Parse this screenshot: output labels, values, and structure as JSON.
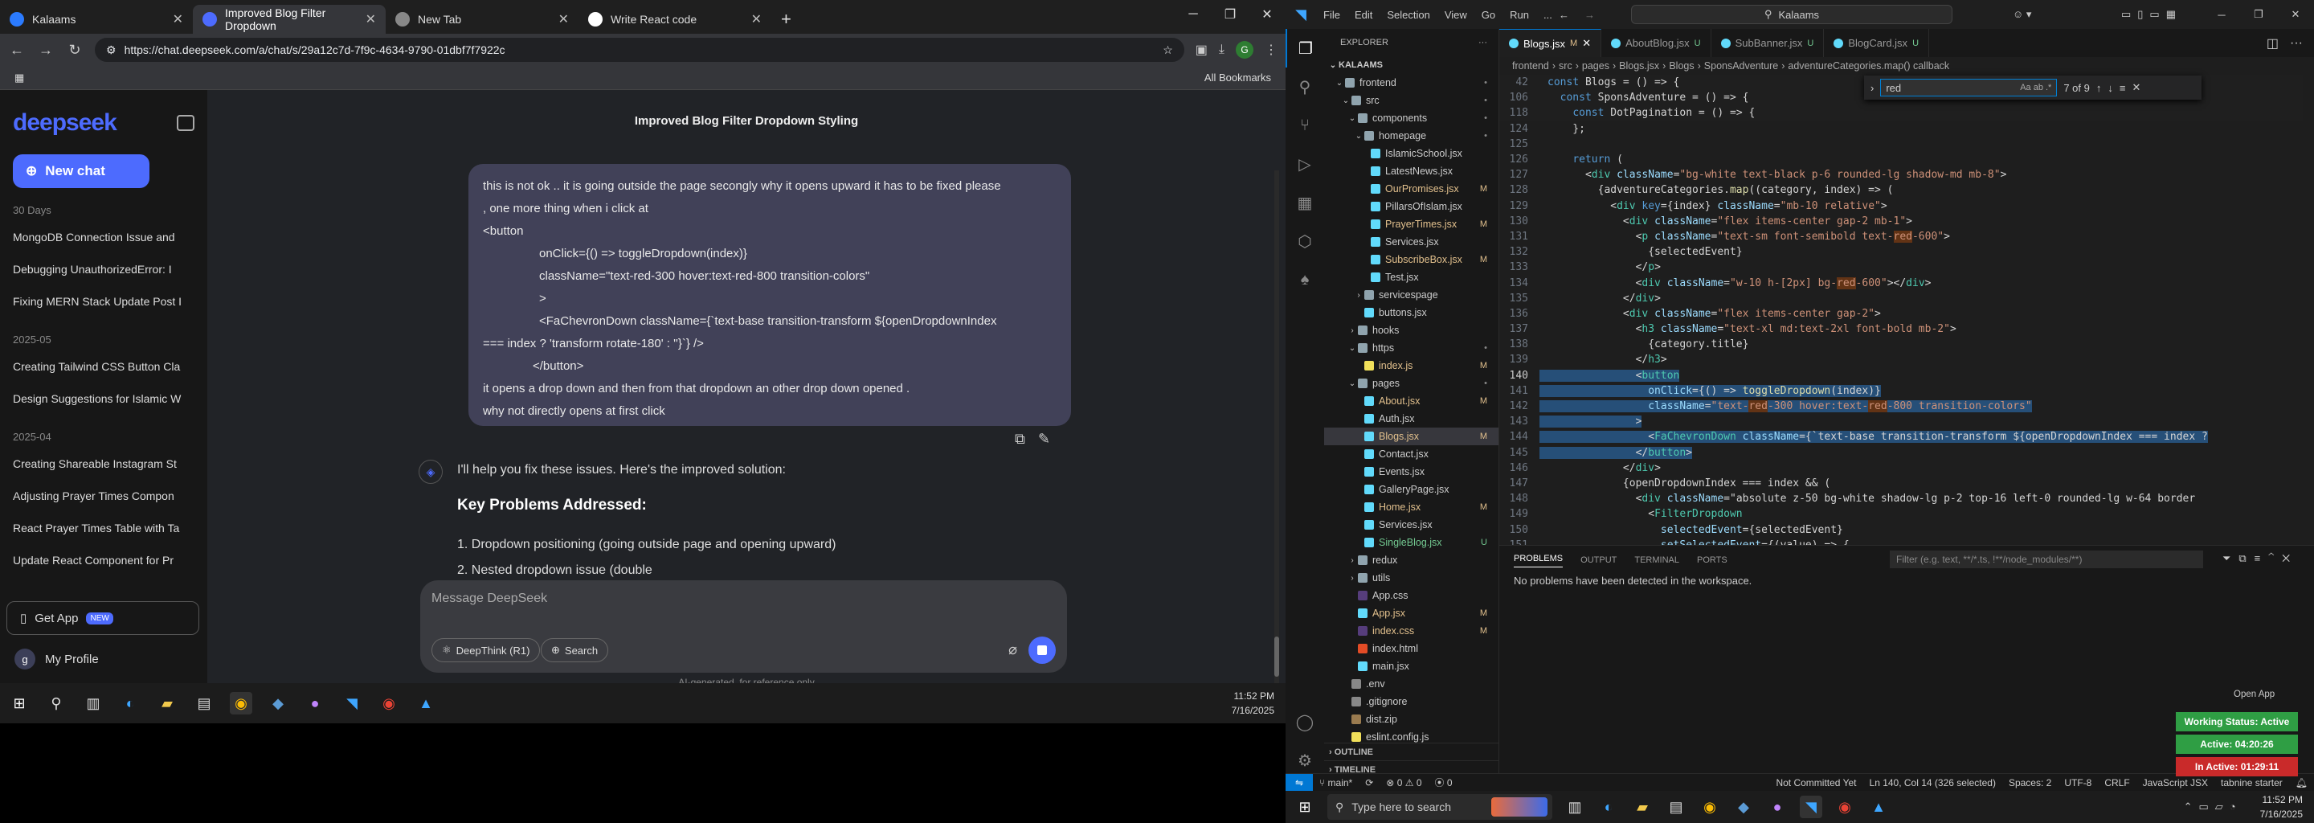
{
  "browser": {
    "tabs": [
      {
        "title": "Kalaams",
        "icon_color": "#2b7bff"
      },
      {
        "title": "Improved Blog Filter Dropdown",
        "icon_color": "#4d6bfe"
      },
      {
        "title": "New Tab",
        "icon_color": "#888888"
      },
      {
        "title": "Write React code",
        "icon_color": "#ffffff"
      }
    ],
    "url": "https://chat.deepseek.com/a/chat/s/29a12c7d-7f9c-4634-9790-01dbf7f7922c",
    "all_bookmarks": "All Bookmarks",
    "profile_letter": "G"
  },
  "deepseek": {
    "logo": "deepseek",
    "new_chat": "New chat",
    "sections": [
      {
        "label": "30 Days",
        "items": [
          "MongoDB Connection Issue and",
          "Debugging UnauthorizedError: I",
          "Fixing MERN Stack Update Post I"
        ]
      },
      {
        "label": "2025-05",
        "items": [
          "Creating Tailwind CSS Button Cla",
          "Design Suggestions for Islamic W"
        ]
      },
      {
        "label": "2025-04",
        "items": [
          "Creating Shareable Instagram St",
          "Adjusting Prayer Times Compon",
          "React Prayer Times Table with Ta",
          "Update React Component for Pr"
        ]
      }
    ],
    "get_app": "Get App",
    "new_badge": "NEW",
    "profile": "My Profile",
    "profile_initial": "g",
    "chat_title": "Improved Blog Filter Dropdown Styling",
    "user_message": [
      "this is not ok .. it is going outside the page secongly why it opens upward it has to be fixed please",
      ", one more thing when i click at",
      " <button",
      "onClick={() => toggleDropdown(index)}",
      "className=\"text-red-300 hover:text-red-800 transition-colors\"",
      ">",
      "<FaChevronDown className={`text-base transition-transform ${openDropdownIndex",
      "=== index ? 'transform rotate-180' : ''}`} />",
      "</button>",
      "it opens a drop down and then from that dropdown an other drop down opened .",
      "why not directly opens at first click"
    ],
    "reply_intro": "I'll help you fix these issues. Here's the improved solution:",
    "reply_heading": "Key Problems Addressed:",
    "reply_points": [
      "1. Dropdown positioning (going outside page and opening upward)",
      "2. Nested dropdown issue (double"
    ],
    "input_placeholder": "Message DeepSeek",
    "deepthink": "DeepThink (R1)",
    "search": "Search",
    "disclaimer": "AI-generated, for reference only"
  },
  "taskbar_left": {
    "time": "11:52 PM",
    "date": "7/16/2025"
  },
  "vscode": {
    "menu": [
      "File",
      "Edit",
      "Selection",
      "View",
      "Go",
      "Run",
      "..."
    ],
    "search": "Kalaams",
    "explorer_title": "EXPLORER",
    "root": "KALAAMS",
    "tree": [
      {
        "name": "frontend",
        "type": "folder",
        "depth": 1,
        "open": true,
        "status": "d"
      },
      {
        "name": "src",
        "type": "folder",
        "depth": 2,
        "open": true,
        "status": "d"
      },
      {
        "name": "components",
        "type": "folder",
        "depth": 3,
        "open": true,
        "status": "d"
      },
      {
        "name": "homepage",
        "type": "folder",
        "depth": 4,
        "open": true,
        "status": "d"
      },
      {
        "name": "IslamicSchool.jsx",
        "type": "file",
        "depth": 5,
        "status": ""
      },
      {
        "name": "LatestNews.jsx",
        "type": "file",
        "depth": 5,
        "status": ""
      },
      {
        "name": "OurPromises.jsx",
        "type": "file",
        "depth": 5,
        "status": "M"
      },
      {
        "name": "PillarsOfIslam.jsx",
        "type": "file",
        "depth": 5,
        "status": ""
      },
      {
        "name": "PrayerTimes.jsx",
        "type": "file",
        "depth": 5,
        "status": "M"
      },
      {
        "name": "Services.jsx",
        "type": "file",
        "depth": 5,
        "status": ""
      },
      {
        "name": "SubscribeBox.jsx",
        "type": "file",
        "depth": 5,
        "status": "M"
      },
      {
        "name": "Test.jsx",
        "type": "file",
        "depth": 5,
        "status": ""
      },
      {
        "name": "servicespage",
        "type": "folder",
        "depth": 4,
        "open": false,
        "status": ""
      },
      {
        "name": "buttons.jsx",
        "type": "file",
        "depth": 4,
        "status": ""
      },
      {
        "name": "hooks",
        "type": "folder",
        "depth": 3,
        "open": false,
        "status": ""
      },
      {
        "name": "https",
        "type": "folder",
        "depth": 3,
        "open": true,
        "status": "d"
      },
      {
        "name": "index.js",
        "type": "file",
        "depth": 4,
        "status": "M"
      },
      {
        "name": "pages",
        "type": "folder",
        "depth": 3,
        "open": true,
        "status": "d"
      },
      {
        "name": "About.jsx",
        "type": "file",
        "depth": 4,
        "status": "M"
      },
      {
        "name": "Auth.jsx",
        "type": "file",
        "depth": 4,
        "status": ""
      },
      {
        "name": "Blogs.jsx",
        "type": "file",
        "depth": 4,
        "status": "M",
        "selected": true
      },
      {
        "name": "Contact.jsx",
        "type": "file",
        "depth": 4,
        "status": ""
      },
      {
        "name": "Events.jsx",
        "type": "file",
        "depth": 4,
        "status": ""
      },
      {
        "name": "GalleryPage.jsx",
        "type": "file",
        "depth": 4,
        "status": ""
      },
      {
        "name": "Home.jsx",
        "type": "file",
        "depth": 4,
        "status": "M"
      },
      {
        "name": "Services.jsx",
        "type": "file",
        "depth": 4,
        "status": ""
      },
      {
        "name": "SingleBlog.jsx",
        "type": "file",
        "depth": 4,
        "status": "U"
      },
      {
        "name": "redux",
        "type": "folder",
        "depth": 3,
        "open": false,
        "status": ""
      },
      {
        "name": "utils",
        "type": "folder",
        "depth": 3,
        "open": false,
        "status": ""
      },
      {
        "name": "App.css",
        "type": "file",
        "depth": 3,
        "status": ""
      },
      {
        "name": "App.jsx",
        "type": "file",
        "depth": 3,
        "status": "M"
      },
      {
        "name": "index.css",
        "type": "file",
        "depth": 3,
        "status": "M"
      },
      {
        "name": "index.html",
        "type": "file",
        "depth": 3,
        "status": ""
      },
      {
        "name": "main.jsx",
        "type": "file",
        "depth": 3,
        "status": ""
      },
      {
        "name": ".env",
        "type": "file",
        "depth": 2,
        "status": ""
      },
      {
        "name": ".gitignore",
        "type": "file",
        "depth": 2,
        "status": ""
      },
      {
        "name": "dist.zip",
        "type": "file",
        "depth": 2,
        "status": ""
      },
      {
        "name": "eslint.config.js",
        "type": "file",
        "depth": 2,
        "status": ""
      }
    ],
    "outline": "OUTLINE",
    "timeline": "TIMELINE",
    "editor_tabs": [
      {
        "name": "Blogs.jsx",
        "status": "M",
        "active": true
      },
      {
        "name": "AboutBlog.jsx",
        "status": "U",
        "active": false
      },
      {
        "name": "SubBanner.jsx",
        "status": "U",
        "active": false
      },
      {
        "name": "BlogCard.jsx",
        "status": "U",
        "active": false
      }
    ],
    "breadcrumbs": [
      "frontend",
      ">",
      "src",
      ">",
      "pages",
      ">",
      "Blogs.jsx",
      ">",
      "Blogs",
      ">",
      "SponsAdventure",
      ">",
      "adventureCategories.map() callback"
    ],
    "find": {
      "query": "red",
      "result": "7 of 9"
    },
    "code_lines": [
      {
        "n": "42",
        "t": "const Blogs = () => {",
        "sticky": true
      },
      {
        "n": "106",
        "t": "  const SponsAdventure = () => {",
        "sticky": true
      },
      {
        "n": "118",
        "t": "    const DotPagination = () => {",
        "sticky": true
      },
      {
        "n": "124",
        "t": "    };"
      },
      {
        "n": "125",
        "t": ""
      },
      {
        "n": "126",
        "t": "    return ("
      },
      {
        "n": "127",
        "t": "      <div className=\"bg-white text-black p-6 rounded-lg shadow-md mb-8\">"
      },
      {
        "n": "128",
        "t": "        {adventureCategories.map((category, index) => ("
      },
      {
        "n": "129",
        "t": "          <div key={index} className=\"mb-10 relative\">"
      },
      {
        "n": "130",
        "t": "            <div className=\"flex items-center gap-2 mb-1\">"
      },
      {
        "n": "131",
        "t": "              <p className=\"text-sm font-semibold text-red-600\">"
      },
      {
        "n": "132",
        "t": "                {selectedEvent}"
      },
      {
        "n": "133",
        "t": "              </p>"
      },
      {
        "n": "134",
        "t": "              <div className=\"w-10 h-[2px] bg-red-600\"></div>"
      },
      {
        "n": "135",
        "t": "            </div>"
      },
      {
        "n": "136",
        "t": "            <div className=\"flex items-center gap-2\">"
      },
      {
        "n": "137",
        "t": "              <h3 className=\"text-xl md:text-2xl font-bold mb-2\">"
      },
      {
        "n": "138",
        "t": "                {category.title}"
      },
      {
        "n": "139",
        "t": "              </h3>"
      },
      {
        "n": "140",
        "t": "              <button",
        "hl": true,
        "cur": true
      },
      {
        "n": "141",
        "t": "                onClick={() => toggleDropdown(index)}",
        "hl": true
      },
      {
        "n": "142",
        "t": "                className=\"text-red-300 hover:text-red-800 transition-colors\"",
        "hl": true
      },
      {
        "n": "143",
        "t": "              >",
        "hl": true
      },
      {
        "n": "144",
        "t": "                <FaChevronDown className={`text-base transition-transform ${openDropdownIndex === index ?",
        "hl": true
      },
      {
        "n": "145",
        "t": "              </button>",
        "hl": true
      },
      {
        "n": "146",
        "t": "            </div>"
      },
      {
        "n": "147",
        "t": "            {openDropdownIndex === index && ("
      },
      {
        "n": "148",
        "t": "              <div className=\"absolute z-50 bg-white shadow-lg p-2 top-16 left-0 rounded-lg w-64 border"
      },
      {
        "n": "149",
        "t": "                <FilterDropdown"
      },
      {
        "n": "150",
        "t": "                  selectedEvent={selectedEvent}"
      },
      {
        "n": "151",
        "t": "                  setSelectedEvent={(value) => {"
      }
    ],
    "panel_tabs": [
      "PROBLEMS",
      "OUTPUT",
      "TERMINAL",
      "PORTS"
    ],
    "panel_filter": "Filter (e.g. text, **/*.ts, !**/node_modules/**)",
    "problems_text": "No problems have been detected in the workspace.",
    "open_app": "Open App",
    "badges": [
      {
        "text": "Working Status: Active",
        "color": "#2f9e44"
      },
      {
        "text": "Active: 04:20:26",
        "color": "#2f9e44"
      },
      {
        "text": "In Active: 01:29:11",
        "color": "#c92a2a"
      }
    ],
    "status": {
      "branch": "main*",
      "errors": "0",
      "warnings": "0",
      "ports": "0",
      "git": "Not Committed Yet",
      "cursor": "Ln 140, Col 14 (326 selected)",
      "spaces": "Spaces: 2",
      "encoding": "UTF-8",
      "eol": "CRLF",
      "language": "JavaScript JSX",
      "tabnine": "tabnine starter"
    }
  },
  "taskbar_right": {
    "search": "Type here to search",
    "time": "11:52 PM",
    "date": "7/16/2025"
  }
}
